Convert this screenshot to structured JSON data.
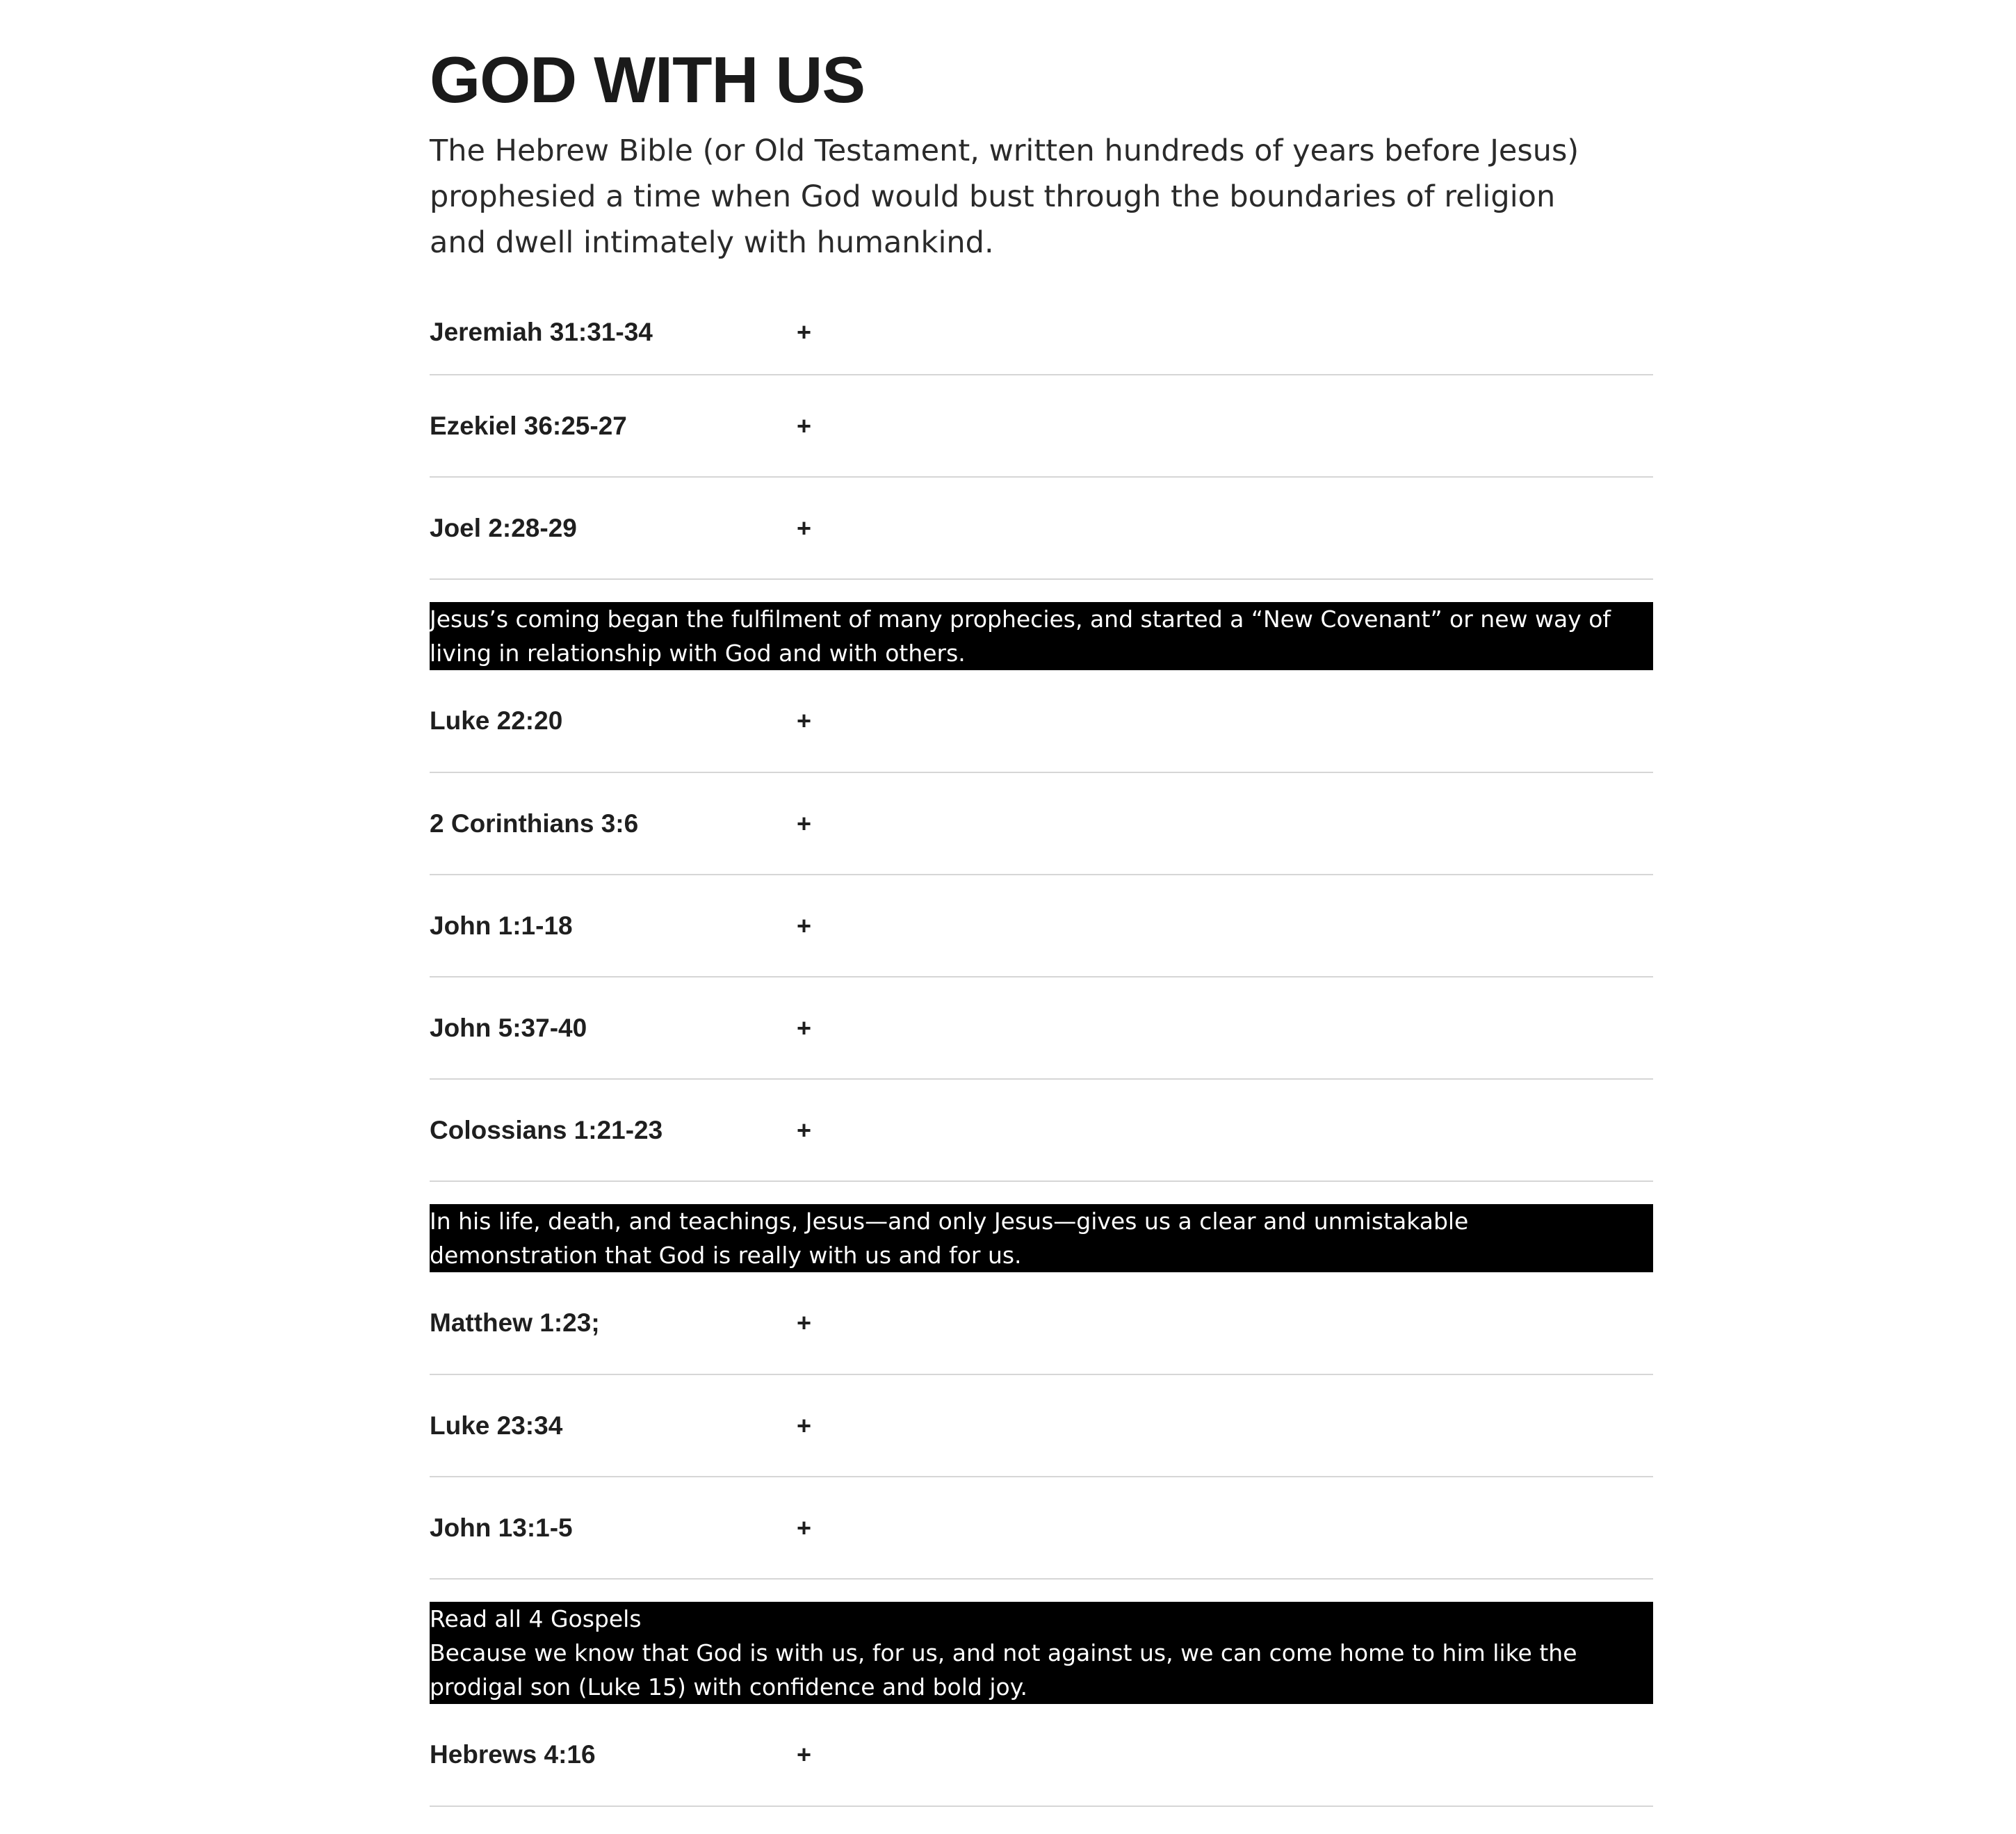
{
  "title": "GOD WITH US",
  "intro": "The Hebrew Bible (or Old Testament, written hundreds of years before Jesus) prophesied a time when God would bust through the boundaries of religion and dwell intimately with humankind.",
  "expand_icon": "+",
  "group1": {
    "items": [
      {
        "label": "Jeremiah 31:31-34"
      },
      {
        "label": "Ezekiel 36:25-27"
      },
      {
        "label": "Joel 2:28-29"
      }
    ]
  },
  "callout1": "Jesus’s coming began the fulfilment of many prophecies, and started a “New Covenant” or new way of living in relationship with God and with others.",
  "group2": {
    "items": [
      {
        "label": "Luke 22:20"
      },
      {
        "label": "2 Corinthians 3:6"
      },
      {
        "label": "John 1:1-18"
      },
      {
        "label": "John 5:37-40"
      },
      {
        "label": "Colossians 1:21-23"
      }
    ]
  },
  "callout2": "In his life, death, and teachings, Jesus—and only Jesus—gives us a clear and unmistakable demonstration that God is really with us and for us.",
  "group3": {
    "items": [
      {
        "label": "Matthew 1:23;"
      },
      {
        "label": "Luke 23:34"
      },
      {
        "label": "John 13:1-5"
      }
    ]
  },
  "callout3": {
    "link": "Read all 4 Gospels",
    "text": "Because we know that God is with us, for us, and not against us, we can come home to him like the prodigal son (Luke 15) with confidence and bold joy."
  },
  "group4": {
    "items": [
      {
        "label": "Hebrews 4:16"
      }
    ]
  }
}
